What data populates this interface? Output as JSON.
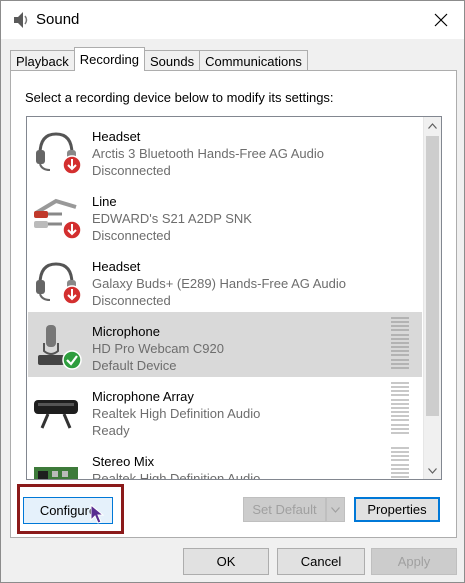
{
  "window": {
    "title": "Sound"
  },
  "tabs": [
    {
      "label": "Playback",
      "active": false
    },
    {
      "label": "Recording",
      "active": true
    },
    {
      "label": "Sounds",
      "active": false
    },
    {
      "label": "Communications",
      "active": false
    }
  ],
  "panel": {
    "instruction": "Select a recording device below to modify its settings:"
  },
  "devices": [
    {
      "name": "Headset",
      "description": "Arctis 3 Bluetooth Hands-Free AG Audio",
      "status": "Disconnected",
      "icon": "headset-icon",
      "badge": "disconnected-badge"
    },
    {
      "name": "Line",
      "description": "EDWARD's S21 A2DP SNK",
      "status": "Disconnected",
      "icon": "line-in-cable-icon",
      "badge": "disconnected-badge"
    },
    {
      "name": "Headset",
      "description": "Galaxy Buds+ (E289) Hands-Free AG Audio",
      "status": "Disconnected",
      "icon": "headset-icon",
      "badge": "disconnected-badge"
    },
    {
      "name": "Microphone",
      "description": "HD Pro Webcam C920",
      "status": "Default Device",
      "icon": "microphone-icon",
      "badge": "default-device-check-badge",
      "selected": true
    },
    {
      "name": "Microphone Array",
      "description": "Realtek High Definition Audio",
      "status": "Ready",
      "icon": "microphone-array-icon"
    },
    {
      "name": "Stereo Mix",
      "description": "Realtek High Definition Audio",
      "status": "",
      "icon": "sound-card-icon"
    }
  ],
  "buttons": {
    "configure": "Configure",
    "set_default": "Set Default",
    "properties": "Properties",
    "ok": "OK",
    "cancel": "Cancel",
    "apply": "Apply"
  },
  "colors": {
    "accent": "#0078d7",
    "selection": "#d9d9d9",
    "highlight_box": "#8b1a1a",
    "disconnected_badge": "#d32f2f",
    "default_badge": "#2e9d3e"
  }
}
